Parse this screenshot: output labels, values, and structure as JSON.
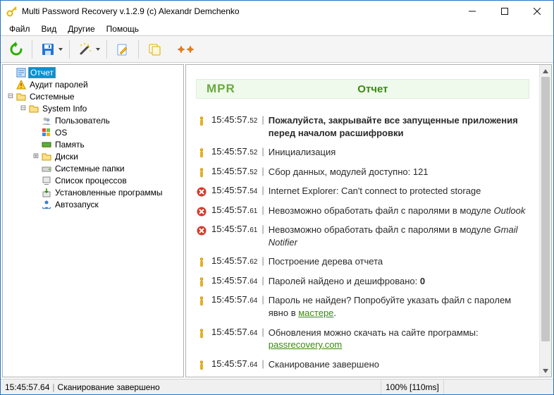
{
  "title": "Multi Password Recovery v.1.2.9 (c) Alexandr Demchenko",
  "menu": {
    "file": "Файл",
    "view": "Вид",
    "other": "Другие",
    "help": "Помощь"
  },
  "tree": {
    "report": "Отчет",
    "audit": "Аудит паролей",
    "system": "Системные",
    "sysinfo": "System Info",
    "user": "Пользователь",
    "os": "OS",
    "memory": "Память",
    "disks": "Диски",
    "sysfolders": "Системные папки",
    "processes": "Список процессов",
    "installed": "Установленные программы",
    "autorun": "Автозапуск"
  },
  "report": {
    "logo": "MPR",
    "title": "Отчет",
    "rows": [
      {
        "icon": "info",
        "ts": "15:45:57",
        "ms": "52",
        "html": "<b>Пожалуйста, закрывайте все запущенные приложения перед началом расшифровки</b>"
      },
      {
        "icon": "info",
        "ts": "15:45:57",
        "ms": "52",
        "html": "Инициализация"
      },
      {
        "icon": "info",
        "ts": "15:45:57",
        "ms": "52",
        "html": "Сбор данных, модулей доступно: 121"
      },
      {
        "icon": "error",
        "ts": "15:45:57",
        "ms": "54",
        "html": "Internet Explorer: Can't connect to protected storage"
      },
      {
        "icon": "error",
        "ts": "15:45:57",
        "ms": "61",
        "html": "Невозможно обработать файл с паролями в модуле <i>Outlook</i>"
      },
      {
        "icon": "error",
        "ts": "15:45:57",
        "ms": "61",
        "html": "Невозможно обработать файл с паролями в модуле <i>Gmail Notifier</i>"
      },
      {
        "icon": "info",
        "ts": "15:45:57",
        "ms": "62",
        "html": "Построение дерева отчета"
      },
      {
        "icon": "info",
        "ts": "15:45:57",
        "ms": "64",
        "html": "Паролей найдено и дешифровано: <b>0</b>"
      },
      {
        "icon": "info",
        "ts": "15:45:57",
        "ms": "64",
        "html": "Пароль не найден? Попробуйте указать файл с паролем явно в <a href='#'>мастере</a>."
      },
      {
        "icon": "info",
        "ts": "15:45:57",
        "ms": "64",
        "html": "Обновления можно скачать на сайте программы: <a href='#'>passrecovery.com</a>"
      },
      {
        "icon": "info",
        "ts": "15:45:57",
        "ms": "64",
        "html": "Сканирование завершено"
      }
    ]
  },
  "status": {
    "left_ts": "15:45:57.64",
    "left_txt": "Сканирование завершено",
    "right": "100% [110ms]"
  }
}
